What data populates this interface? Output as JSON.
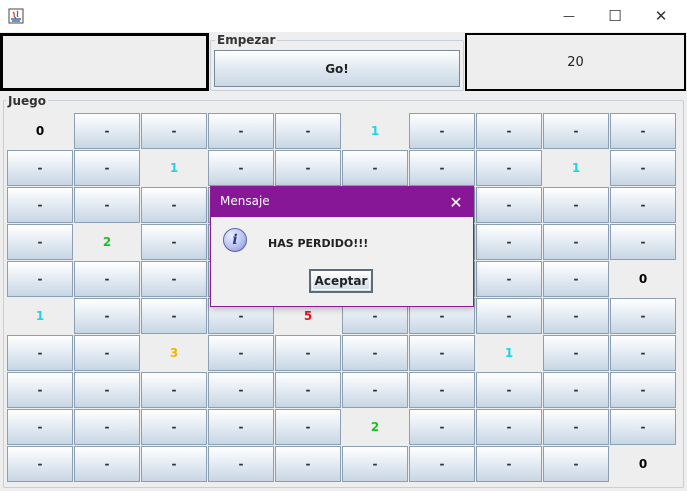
{
  "window": {
    "title": "",
    "minimize_glyph": "—",
    "maximize_glyph": "☐",
    "close_glyph": "✕"
  },
  "top": {
    "left_display": "",
    "empezar_label": "Empezar",
    "go_label": "Go!",
    "right_display": "20"
  },
  "juego_label": "Juego",
  "colors": {
    "one": "#1ed4e6",
    "two": "#19c31e",
    "three": "#f5b400",
    "five": "#e0121c",
    "zero": "#000000",
    "dialog_title": "#881798"
  },
  "board": {
    "rows": [
      [
        {
          "t": "0",
          "o": true,
          "c": "zero"
        },
        {
          "t": "-"
        },
        {
          "t": "-"
        },
        {
          "t": "-"
        },
        {
          "t": "-"
        },
        {
          "t": "1",
          "o": true,
          "c": "one"
        },
        {
          "t": "-"
        },
        {
          "t": "-"
        },
        {
          "t": "-"
        },
        {
          "t": "-"
        }
      ],
      [
        {
          "t": "-"
        },
        {
          "t": "-"
        },
        {
          "t": "1",
          "o": true,
          "c": "one"
        },
        {
          "t": "-"
        },
        {
          "t": "-"
        },
        {
          "t": "-"
        },
        {
          "t": "-"
        },
        {
          "t": "-"
        },
        {
          "t": "1",
          "o": true,
          "c": "one"
        },
        {
          "t": "-"
        }
      ],
      [
        {
          "t": "-"
        },
        {
          "t": "-"
        },
        {
          "t": "-"
        },
        {
          "t": "-"
        },
        {
          "t": "-"
        },
        {
          "t": "-"
        },
        {
          "t": "-"
        },
        {
          "t": "-"
        },
        {
          "t": "-"
        },
        {
          "t": "-"
        }
      ],
      [
        {
          "t": "-"
        },
        {
          "t": "2",
          "o": true,
          "c": "two"
        },
        {
          "t": "-"
        },
        {
          "t": "-"
        },
        {
          "t": "-"
        },
        {
          "t": "-"
        },
        {
          "t": "-"
        },
        {
          "t": "-"
        },
        {
          "t": "-"
        },
        {
          "t": "-"
        }
      ],
      [
        {
          "t": "-"
        },
        {
          "t": "-"
        },
        {
          "t": "-"
        },
        {
          "t": "-"
        },
        {
          "t": "-"
        },
        {
          "t": "-"
        },
        {
          "t": "-"
        },
        {
          "t": "-"
        },
        {
          "t": "-"
        },
        {
          "t": "0",
          "o": true,
          "c": "zero"
        }
      ],
      [
        {
          "t": "1",
          "o": true,
          "c": "one"
        },
        {
          "t": "-"
        },
        {
          "t": "-"
        },
        {
          "t": "-"
        },
        {
          "t": "5",
          "o": true,
          "c": "five"
        },
        {
          "t": "-"
        },
        {
          "t": "-"
        },
        {
          "t": "-"
        },
        {
          "t": "-"
        },
        {
          "t": "-"
        }
      ],
      [
        {
          "t": "-"
        },
        {
          "t": "-"
        },
        {
          "t": "3",
          "o": true,
          "c": "three"
        },
        {
          "t": "-"
        },
        {
          "t": "-"
        },
        {
          "t": "-"
        },
        {
          "t": "-"
        },
        {
          "t": "1",
          "o": true,
          "c": "one"
        },
        {
          "t": "-"
        },
        {
          "t": "-"
        }
      ],
      [
        {
          "t": "-"
        },
        {
          "t": "-"
        },
        {
          "t": "-"
        },
        {
          "t": "-"
        },
        {
          "t": "-"
        },
        {
          "t": "-"
        },
        {
          "t": "-"
        },
        {
          "t": "-"
        },
        {
          "t": "-"
        },
        {
          "t": "-"
        }
      ],
      [
        {
          "t": "-"
        },
        {
          "t": "-"
        },
        {
          "t": "-"
        },
        {
          "t": "-"
        },
        {
          "t": "-"
        },
        {
          "t": "2",
          "o": true,
          "c": "two"
        },
        {
          "t": "-"
        },
        {
          "t": "-"
        },
        {
          "t": "-"
        },
        {
          "t": "-"
        }
      ],
      [
        {
          "t": "-"
        },
        {
          "t": "-"
        },
        {
          "t": "-"
        },
        {
          "t": "-"
        },
        {
          "t": "-"
        },
        {
          "t": "-"
        },
        {
          "t": "-"
        },
        {
          "t": "-"
        },
        {
          "t": "-"
        },
        {
          "t": "0",
          "o": true,
          "c": "zero"
        }
      ]
    ]
  },
  "dialog": {
    "title": "Mensaje",
    "close_glyph": "✕",
    "icon": "info-icon",
    "icon_glyph": "i",
    "message": "HAS PERDIDO!!!",
    "ok_label": "Aceptar"
  }
}
